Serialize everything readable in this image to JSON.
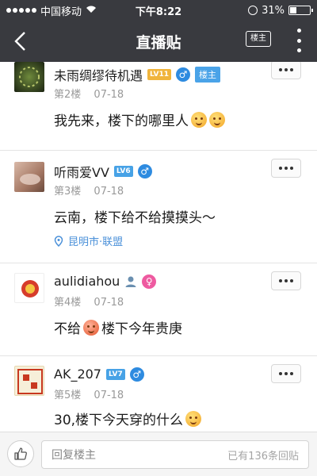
{
  "status_bar": {
    "carrier": "中国移动",
    "time": "下午8:22",
    "battery": "31%",
    "battery_level": 0.31
  },
  "nav": {
    "title": "直播贴",
    "louzhu_button": "楼主"
  },
  "posts": [
    {
      "username": "未雨绸缪待机遇",
      "level": "LV11",
      "gender": "male",
      "tag": "楼主",
      "floor": "第2楼",
      "date": "07-18",
      "content": "我先来，楼下的哪里人",
      "emojis": [
        "angry-face-icon",
        "angry-face-icon"
      ]
    },
    {
      "username": "听雨爱VV",
      "level": "LV6",
      "gender": "male",
      "floor": "第3楼",
      "date": "07-18",
      "content": "云南，楼下给不给摸摸头～",
      "location": "昆明市·联盟"
    },
    {
      "username": "aulidiahou",
      "gender": "female",
      "floor": "第4楼",
      "date": "07-18",
      "content_before": "不给",
      "content_after": "楼下今年贵庚"
    },
    {
      "username": "AK_207",
      "level": "LV7",
      "gender": "male",
      "floor": "第5楼",
      "date": "07-18",
      "content": "30,楼下今天穿的什么"
    }
  ],
  "bottom_bar": {
    "reply_placeholder": "回复楼主",
    "reply_count": "已有136条回贴"
  },
  "colors": {
    "header_bg": "#393a3f",
    "level_gold": "#f0b43c",
    "level_blue": "#47a2e6",
    "male": "#2e8be0",
    "female": "#ee5aa0",
    "link_blue": "#4a90d9"
  }
}
